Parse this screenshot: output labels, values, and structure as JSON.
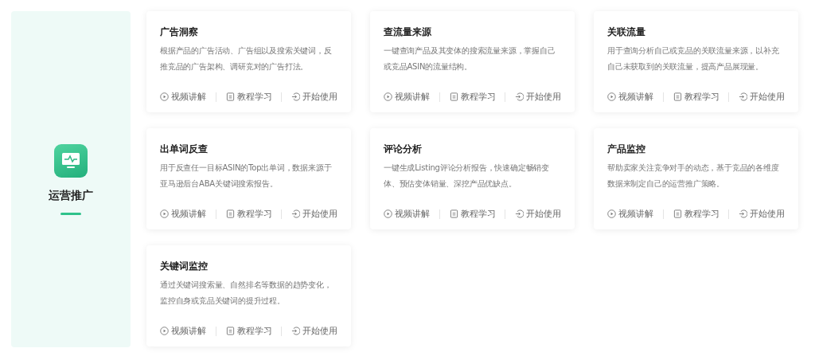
{
  "category": {
    "title": "运营推广",
    "selected": true
  },
  "cards": [
    {
      "title": "广告洞察",
      "description": "根据产品的广告活动、广告组以及搜索关键词，反推竞品的广告架构、调研竞对的广告打法。",
      "actions": [
        {
          "kind": "video",
          "label": "视频讲解"
        },
        {
          "kind": "tutorial",
          "label": "教程学习"
        },
        {
          "kind": "start",
          "label": "开始使用"
        }
      ]
    },
    {
      "title": "查流量来源",
      "description": "一键查询产品及其变体的搜索流量来源，掌握自己或竞品ASIN的流量结构。",
      "actions": [
        {
          "kind": "video",
          "label": "视频讲解"
        },
        {
          "kind": "tutorial",
          "label": "教程学习"
        },
        {
          "kind": "start",
          "label": "开始使用"
        }
      ]
    },
    {
      "title": "关联流量",
      "description": "用于查询分析自己或竞品的关联流量来源，以补充自己未获取到的关联流量，提高产品展现量。",
      "actions": [
        {
          "kind": "video",
          "label": "视频讲解"
        },
        {
          "kind": "tutorial",
          "label": "教程学习"
        },
        {
          "kind": "start",
          "label": "开始使用"
        }
      ]
    },
    {
      "title": "出单词反查",
      "description": "用于反查任一目标ASIN的Top出单词，数据来源于亚马逊后台ABA关键词搜索报告。",
      "actions": [
        {
          "kind": "video",
          "label": "视频讲解"
        },
        {
          "kind": "tutorial",
          "label": "教程学习"
        },
        {
          "kind": "start",
          "label": "开始使用"
        }
      ]
    },
    {
      "title": "评论分析",
      "description": "一键生成Listing评论分析报告，快速确定畅销变体、预估变体销量、深挖产品优缺点。",
      "actions": [
        {
          "kind": "video",
          "label": "视频讲解"
        },
        {
          "kind": "tutorial",
          "label": "教程学习"
        },
        {
          "kind": "start",
          "label": "开始使用"
        }
      ]
    },
    {
      "title": "产品监控",
      "description": "帮助卖家关注竞争对手的动态，基于竞品的各维度数据来制定自己的运营推广策略。",
      "actions": [
        {
          "kind": "video",
          "label": "视频讲解"
        },
        {
          "kind": "tutorial",
          "label": "教程学习"
        },
        {
          "kind": "start",
          "label": "开始使用"
        }
      ]
    },
    {
      "title": "关键词监控",
      "description": "通过关键词搜索量、自然排名等数据的趋势变化，监控自身或竞品关键词的提升过程。",
      "actions": [
        {
          "kind": "video",
          "label": "视频讲解"
        },
        {
          "kind": "tutorial",
          "label": "教程学习"
        },
        {
          "kind": "start",
          "label": "开始使用"
        }
      ]
    }
  ]
}
